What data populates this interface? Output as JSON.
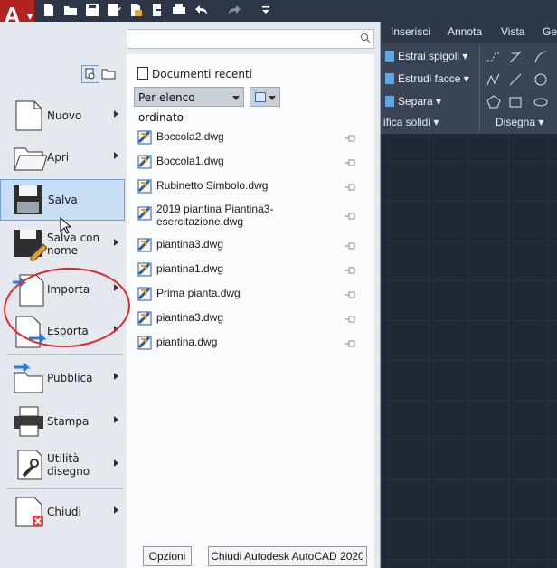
{
  "ribbon": {
    "tabs": [
      "Inserisci",
      "Annota",
      "Vista",
      "Ges"
    ],
    "buttons": [
      "Estrai spigoli",
      "Estrudi facce",
      "Separa"
    ],
    "panel_label_left": "ifica solidi",
    "panel_label_draw": "Disegna"
  },
  "menu": {
    "search_placeholder": "",
    "items": [
      {
        "label": "Nuovo",
        "icon": "new-document-icon"
      },
      {
        "label": "Apri",
        "icon": "open-folder-icon"
      },
      {
        "label": "Salva",
        "icon": "save-disk-icon"
      },
      {
        "label": "Salva con nome",
        "icon": "save-as-icon"
      },
      {
        "label": "Importa",
        "icon": "import-icon"
      },
      {
        "label": "Esporta",
        "icon": "export-icon"
      },
      {
        "label": "Pubblica",
        "icon": "publish-icon"
      },
      {
        "label": "Stampa",
        "icon": "printer-icon"
      },
      {
        "label": "Utilità disegno",
        "icon": "wrench-icon"
      },
      {
        "label": "Chiudi",
        "icon": "close-document-icon"
      }
    ],
    "recent_title": "Documenti recenti",
    "sort_value": "Per elenco ordinato",
    "files": [
      "Boccola2.dwg",
      "Boccola1.dwg",
      "Rubinetto Simbolo.dwg",
      "2019 piantina Piantina3-\nesercitazione.dwg",
      "piantina3.dwg",
      "piantina1.dwg",
      "Prima pianta.dwg",
      "piantina3.dwg",
      "piantina.dwg"
    ],
    "options_label": "Opzioni",
    "exit_label": "Chiudi Autodesk AutoCAD 2020"
  },
  "colors": {
    "app_button": "#b42121",
    "annotation_circle": "#e0282a",
    "selected_item": "#c8def4"
  }
}
